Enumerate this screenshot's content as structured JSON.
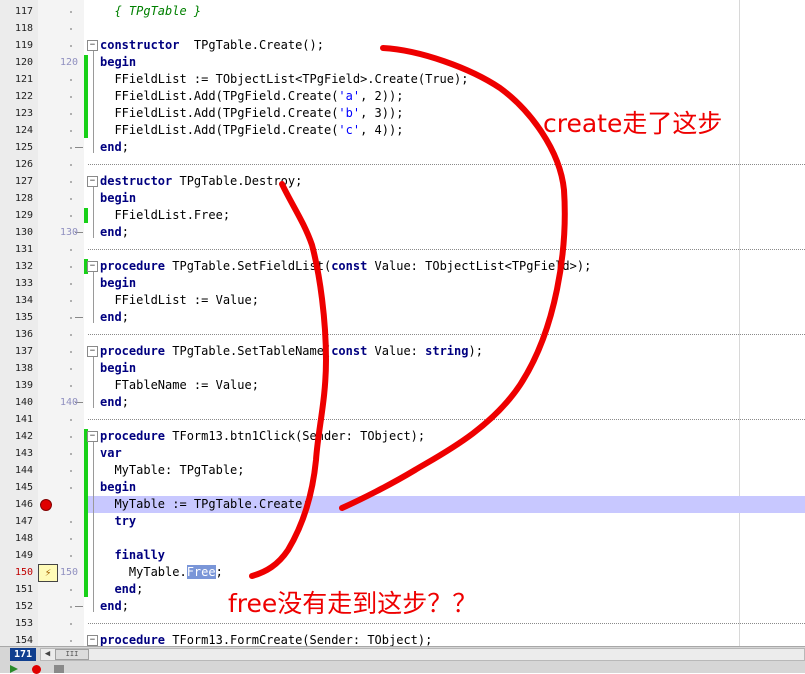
{
  "editor": {
    "current_line": "171",
    "lines": [
      {
        "n": "117",
        "code": [
          [
            "cmt",
            "  { TPgTable }"
          ]
        ]
      },
      {
        "n": "118",
        "code": []
      },
      {
        "n": "119",
        "code": [
          [
            "kw",
            "constructor"
          ],
          [
            "",
            "  TPgTable.Create();"
          ]
        ]
      },
      {
        "n": "120",
        "code": [
          [
            "kw",
            "begin"
          ]
        ]
      },
      {
        "n": "121",
        "code": [
          [
            "",
            "  FFieldList := TObjectList<TPgField>.Create(True);"
          ]
        ]
      },
      {
        "n": "122",
        "code": [
          [
            "",
            "  FFieldList.Add(TPgField.Create("
          ],
          [
            "str",
            "'a'"
          ],
          [
            "",
            ", 2));"
          ]
        ]
      },
      {
        "n": "123",
        "code": [
          [
            "",
            "  FFieldList.Add(TPgField.Create("
          ],
          [
            "str",
            "'b'"
          ],
          [
            "",
            ", 3));"
          ]
        ]
      },
      {
        "n": "124",
        "code": [
          [
            "",
            "  FFieldList.Add(TPgField.Create("
          ],
          [
            "str",
            "'c'"
          ],
          [
            "",
            ", 4));"
          ]
        ]
      },
      {
        "n": "125",
        "code": [
          [
            "kw",
            "end"
          ],
          [
            "",
            ";"
          ]
        ]
      },
      {
        "n": "126",
        "code": []
      },
      {
        "n": "127",
        "code": [
          [
            "kw",
            "destructor"
          ],
          [
            "",
            " TPgTable.Destroy;"
          ]
        ]
      },
      {
        "n": "128",
        "code": [
          [
            "kw",
            "begin"
          ]
        ]
      },
      {
        "n": "129",
        "code": [
          [
            "",
            "  FFieldList.Free;"
          ]
        ]
      },
      {
        "n": "130",
        "code": [
          [
            "kw",
            "end"
          ],
          [
            "",
            ";"
          ]
        ]
      },
      {
        "n": "131",
        "code": []
      },
      {
        "n": "132",
        "code": [
          [
            "kw",
            "procedure"
          ],
          [
            "",
            " TPgTable.SetFieldList("
          ],
          [
            "kw",
            "const"
          ],
          [
            "",
            " Value: TObjectList<TPgField>);"
          ]
        ]
      },
      {
        "n": "133",
        "code": [
          [
            "kw",
            "begin"
          ]
        ]
      },
      {
        "n": "134",
        "code": [
          [
            "",
            "  FFieldList := Value;"
          ]
        ]
      },
      {
        "n": "135",
        "code": [
          [
            "kw",
            "end"
          ],
          [
            "",
            ";"
          ]
        ]
      },
      {
        "n": "136",
        "code": []
      },
      {
        "n": "137",
        "code": [
          [
            "kw",
            "procedure"
          ],
          [
            "",
            " TPgTable.SetTableName("
          ],
          [
            "kw",
            "const"
          ],
          [
            "",
            " Value: "
          ],
          [
            "kw",
            "string"
          ],
          [
            "",
            ");"
          ]
        ]
      },
      {
        "n": "138",
        "code": [
          [
            "kw",
            "begin"
          ]
        ]
      },
      {
        "n": "139",
        "code": [
          [
            "",
            "  FTableName := Value;"
          ]
        ]
      },
      {
        "n": "140",
        "code": [
          [
            "kw",
            "end"
          ],
          [
            "",
            ";"
          ]
        ]
      },
      {
        "n": "141",
        "code": []
      },
      {
        "n": "142",
        "code": [
          [
            "kw",
            "procedure"
          ],
          [
            "",
            " TForm13.btn1Click(Sender: TObject);"
          ]
        ]
      },
      {
        "n": "143",
        "code": [
          [
            "kw",
            "var"
          ]
        ]
      },
      {
        "n": "144",
        "code": [
          [
            "",
            "  MyTable: TPgTable;"
          ]
        ]
      },
      {
        "n": "145",
        "code": [
          [
            "kw",
            "begin"
          ]
        ]
      },
      {
        "n": "146",
        "code": [
          [
            "",
            "  MyTable := TPgTable.Create;"
          ]
        ]
      },
      {
        "n": "147",
        "code": [
          [
            "kw",
            "  try"
          ]
        ]
      },
      {
        "n": "148",
        "code": []
      },
      {
        "n": "149",
        "code": [
          [
            "kw",
            "  finally"
          ]
        ]
      },
      {
        "n": "150",
        "code": [
          [
            "",
            "    MyTable."
          ],
          [
            "sel",
            "Free"
          ],
          [
            "",
            ";"
          ]
        ]
      },
      {
        "n": "151",
        "code": [
          [
            "kw",
            "  end"
          ],
          [
            "",
            ";"
          ]
        ]
      },
      {
        "n": "152",
        "code": [
          [
            "kw",
            "end"
          ],
          [
            "",
            ";"
          ]
        ]
      },
      {
        "n": "153",
        "code": []
      },
      {
        "n": "154",
        "code": [
          [
            "kw",
            "procedure"
          ],
          [
            "",
            " TForm13.FormCreate(Sender: TObject);"
          ]
        ]
      }
    ],
    "gutter_marks": {
      "120": "120",
      "130": "130",
      "140": "140",
      "150": "150"
    },
    "breakpoint_line": "146",
    "exec_line": "150",
    "current_red_line": "150"
  },
  "annotations": {
    "create_note": "create走了这步",
    "free_note": "free没有走到这步？？"
  },
  "colors": {
    "annotation": "#ee0000",
    "highlight_line": "#c8c8ff",
    "modified_bar": "#18d018",
    "keyword": "#000080",
    "string": "#0000ff",
    "comment": "#008000"
  },
  "icons": {
    "breakpoint": "breakpoint-icon",
    "exec_point": "execution-point-icon",
    "fold": "fold-toggle-icon"
  },
  "statusbar": {
    "scroll_thumb_label": "III"
  }
}
